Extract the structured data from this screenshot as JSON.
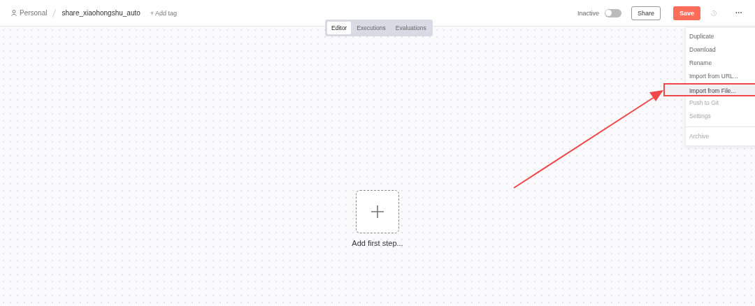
{
  "breadcrumb": {
    "project": "Personal",
    "workflow": "share_xiaohongshu_auto",
    "add_tag": "+ Add tag"
  },
  "status": {
    "label": "Inactive",
    "active": false
  },
  "buttons": {
    "share": "Share",
    "save": "Save",
    "more": "···"
  },
  "tabs": [
    {
      "label": "Editor",
      "selected": true
    },
    {
      "label": "Executions",
      "selected": false
    },
    {
      "label": "Evaluations",
      "selected": false
    }
  ],
  "menu": [
    {
      "label": "Duplicate",
      "disabled": false,
      "highlighted": false,
      "separator_before": false
    },
    {
      "label": "Download",
      "disabled": false,
      "highlighted": false,
      "separator_before": false
    },
    {
      "label": "Rename",
      "disabled": false,
      "highlighted": false,
      "separator_before": false
    },
    {
      "label": "Import from URL...",
      "disabled": false,
      "highlighted": false,
      "separator_before": false
    },
    {
      "label": "Import from File...",
      "disabled": false,
      "highlighted": true,
      "separator_before": false
    },
    {
      "label": "Push to Git",
      "disabled": true,
      "highlighted": false,
      "separator_before": false
    },
    {
      "label": "Settings",
      "disabled": true,
      "highlighted": false,
      "separator_before": false
    },
    {
      "label": "Archive",
      "disabled": true,
      "highlighted": false,
      "separator_before": true
    }
  ],
  "canvas": {
    "add_step": "Add first step..."
  }
}
